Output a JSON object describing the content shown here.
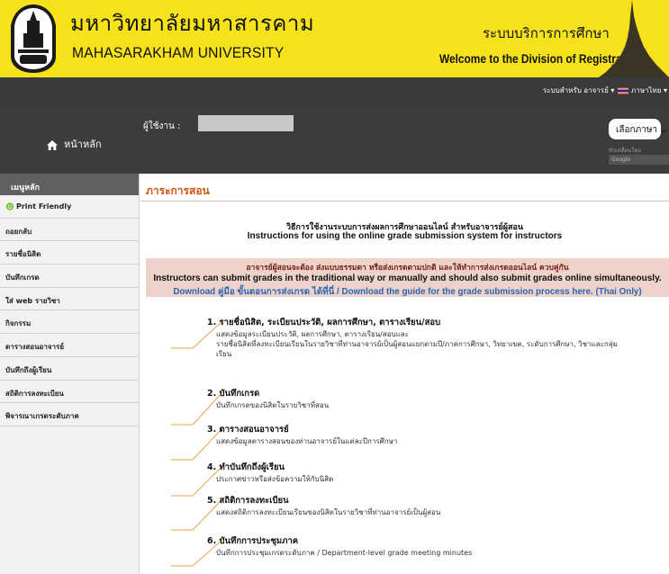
{
  "banner": {
    "university_th": "มหาวิทยาลัยมหาสารคาม",
    "university_en": "MAHASARAKHAM UNIVERSITY",
    "system_th": "ระบบบริการการศึกษา",
    "system_en": "Welcome to the Division of Registration"
  },
  "topnav": {
    "role_menu": "ระบบสำหรับ อาจารย์ ▾",
    "lang_menu": "ภาษาไทย ▾"
  },
  "header": {
    "home_label": "หน้าหลัก",
    "user_label": "ผู้ใช้งาน :",
    "lang_select": "เลือกภาษา ⌄",
    "lang_sub": "ขับเคลื่อนโดย",
    "google": "Google"
  },
  "sidebar": {
    "heading": "เมนูหลัก",
    "items": [
      {
        "label": "Print Friendly"
      },
      {
        "label": "ถอยกลับ"
      },
      {
        "label": "รายชื่อนิสิต"
      },
      {
        "label": "บันทึกเกรด"
      },
      {
        "label": "ใส่ web รายวิชา"
      },
      {
        "label": "กิจกรรม"
      },
      {
        "label": "ตารางสอนอาจารย์"
      },
      {
        "label": "บันทึกถึงผู้เรียน"
      },
      {
        "label": "สถิติการลงทะเบียน"
      },
      {
        "label": "พิจารณาเกรดระดับภาค"
      }
    ]
  },
  "main": {
    "section_title": "ภาระการสอน",
    "instr_th": "วิธีการใช้งานระบบการส่งผลการศึกษาออนไลน์ สำหรับอาจารย์ผู้สอน",
    "instr_en": "Instructions for using the online grade submission system for instructors",
    "notice_th": "อาจารย์ผู้สอนจะต้อง ส่งแบบธรรมดา หรือส่งเกรดตามปกติ และให้ทำการส่งเกรดออนไลน์ ควบคู่กัน",
    "notice_en": "Instructors can submit grades in the traditional way or manually and should also submit grades online simultaneously.",
    "download": "Download คู่มือ ขั้นตอนการส่งเกรด ได้ที่นี่ / Download the guide for the grade submission process here. (Thai Only)",
    "steps": [
      {
        "title": "1. รายชื่อนิสิต, ระเบียนประวัติ, ผลการศึกษา, ตารางเรียน/สอบ",
        "desc": [
          "แสดงข้อมูลระเบียนประวัติ, ผลการศึกษา, ตารางเรียน/สอบและ",
          "รายชื่อนิสิตที่ลงทะเบียนเรียนในรายวิชาที่ท่านอาจารย์เป็นผู้สอนแยกตามปี/ภาคการศึกษา, วิทยาเขต, ระดับการศึกษา, วิชาและกลุ่ม",
          "เรียน"
        ]
      },
      {
        "title": "2. บันทึกเกรด",
        "desc": [
          "บันทึกเกรดของนิสิตในรายวิชาที่สอน"
        ]
      },
      {
        "title": "3. ตารางสอนอาจารย์",
        "desc": [
          "แสดงข้อมูลตารางสอนของท่านอาจารย์ในแต่ละปีการศึกษา"
        ]
      },
      {
        "title": "4. ทำบันทึกถึงผู้เรียน",
        "desc": [
          "ประกาศข่าวหรือส่งข้อความให้กับนิสิต"
        ]
      },
      {
        "title": "5. สถิติการลงทะเบียน",
        "desc": [
          "แสดงสถิติการลงทะเบียนเรียนของนิสิตในรายวิชาที่ท่านอาจารย์เป็นผู้สอน"
        ]
      },
      {
        "title": "6. บันทึกการประชุมภาค",
        "desc": [
          "บันทึกการประชุมเกรดระดับภาค / Department-level grade meeting minutes"
        ]
      }
    ]
  },
  "colors": {
    "banner": "#f6e21a",
    "nav": "#3a3a3a",
    "accent": "#d05510",
    "notice_bg": "#ecd2c9",
    "link": "#2a66b3"
  }
}
